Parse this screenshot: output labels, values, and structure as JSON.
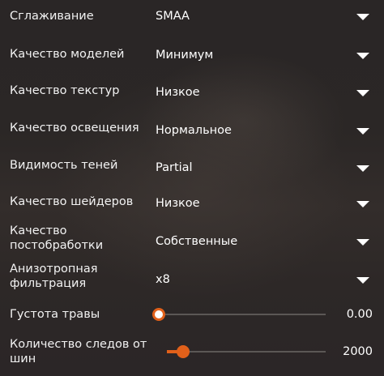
{
  "settings": {
    "antialiasing": {
      "label": "Сглаживание",
      "value": "SMAA"
    },
    "model_quality": {
      "label": "Качество моделей",
      "value": "Минимум"
    },
    "texture_quality": {
      "label": "Качество текстур",
      "value": "Низкое"
    },
    "lighting_quality": {
      "label": "Качество освещения",
      "value": "Нормальное"
    },
    "shadow_visibility": {
      "label": "Видимость теней",
      "value": "Partial"
    },
    "shader_quality": {
      "label": "Качество шейдеров",
      "value": "Низкое"
    },
    "postprocessing_quality": {
      "label": "Качество\nпостобработки",
      "value": "Собственные"
    },
    "anisotropic_filtering": {
      "label": "Анизотропная\nфильтрация",
      "value": "x8"
    },
    "grass_density": {
      "label": "Густота травы",
      "value": "0.00",
      "fraction": 0.0
    },
    "tire_tracks": {
      "label": "Количество следов от\nшин",
      "value": "2000",
      "fraction": 0.1
    }
  },
  "colors": {
    "accent": "#e1601a",
    "text": "#ffffff"
  },
  "icons": {
    "dropdown": "chevron-down-icon"
  }
}
